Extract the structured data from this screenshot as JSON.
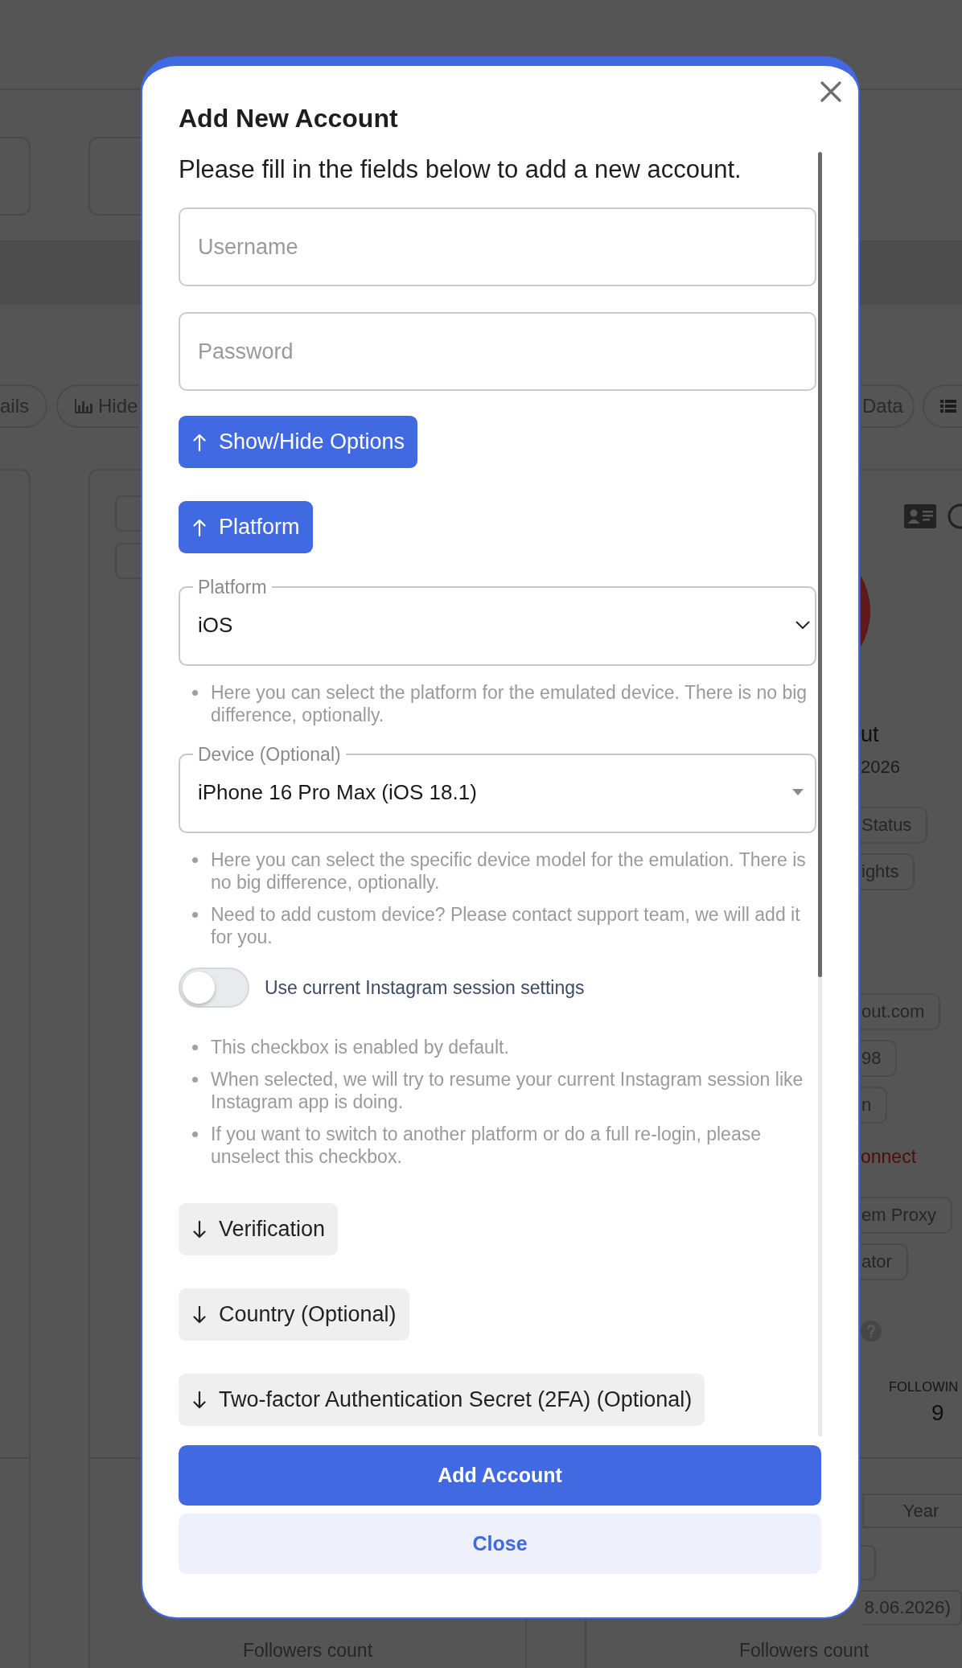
{
  "background": {
    "pills_left": [
      {
        "kind": "text",
        "label": "ails"
      },
      {
        "kind": "chart",
        "label": "Hide"
      }
    ],
    "pills_right": [
      {
        "kind": "text",
        "label": "Data"
      },
      {
        "kind": "list"
      }
    ],
    "profile": {
      "name": "ut",
      "date": "2026",
      "buttons": [
        "Status",
        "ights"
      ],
      "chips": [
        "out.com",
        "98",
        "n"
      ],
      "link": "onnect",
      "tags": [
        "em Proxy",
        "ator"
      ],
      "stat": {
        "label": "FOLLOWIN",
        "value": "9"
      }
    },
    "period_tabs": [
      {
        "label": "Year",
        "selected": false
      }
    ],
    "date_range": "8.06.2026)",
    "chart_captions": [
      "Followers count",
      "Followers count"
    ]
  },
  "modal": {
    "title": "Add New Account",
    "intro": "Please fill in the fields below to add a new account.",
    "fields": [
      {
        "placeholder": "Username"
      },
      {
        "placeholder": "Password"
      }
    ],
    "options_button": {
      "label": "Show/Hide Options",
      "expanded": true
    },
    "sections": [
      {
        "label": "Platform",
        "expanded": true,
        "content": [
          {
            "kind": "select",
            "legend": "Platform",
            "value": "iOS"
          },
          {
            "kind": "hints",
            "items": [
              "Here you can select the platform for the emulated device. There is no big difference, optionally."
            ]
          },
          {
            "kind": "autocomplete",
            "legend": "Device (Optional)",
            "value": "iPhone 16 Pro Max (iOS 18.1)"
          },
          {
            "kind": "hints",
            "items": [
              "Here you can select the specific device model for the emulation. There is no big difference, optionally.",
              "Need to add custom device? Please contact support team, we will add it for you."
            ]
          },
          {
            "kind": "switch",
            "label": "Use current Instagram session settings",
            "on": false
          },
          {
            "kind": "hints",
            "items": [
              "This checkbox is enabled by default.",
              "When selected, we will try to resume your current Instagram session like Instagram app is doing.",
              "If you want to switch to another platform or do a full re-login, please unselect this checkbox."
            ]
          }
        ]
      },
      {
        "label": "Verification",
        "expanded": false
      },
      {
        "label": "Country (Optional)",
        "expanded": false
      },
      {
        "label": "Two-factor Authentication Secret (2FA) (Optional)",
        "expanded": false
      }
    ],
    "buttons": [
      {
        "kind": "primary",
        "label": "Add Account"
      },
      {
        "kind": "secondary",
        "label": "Close"
      }
    ]
  }
}
